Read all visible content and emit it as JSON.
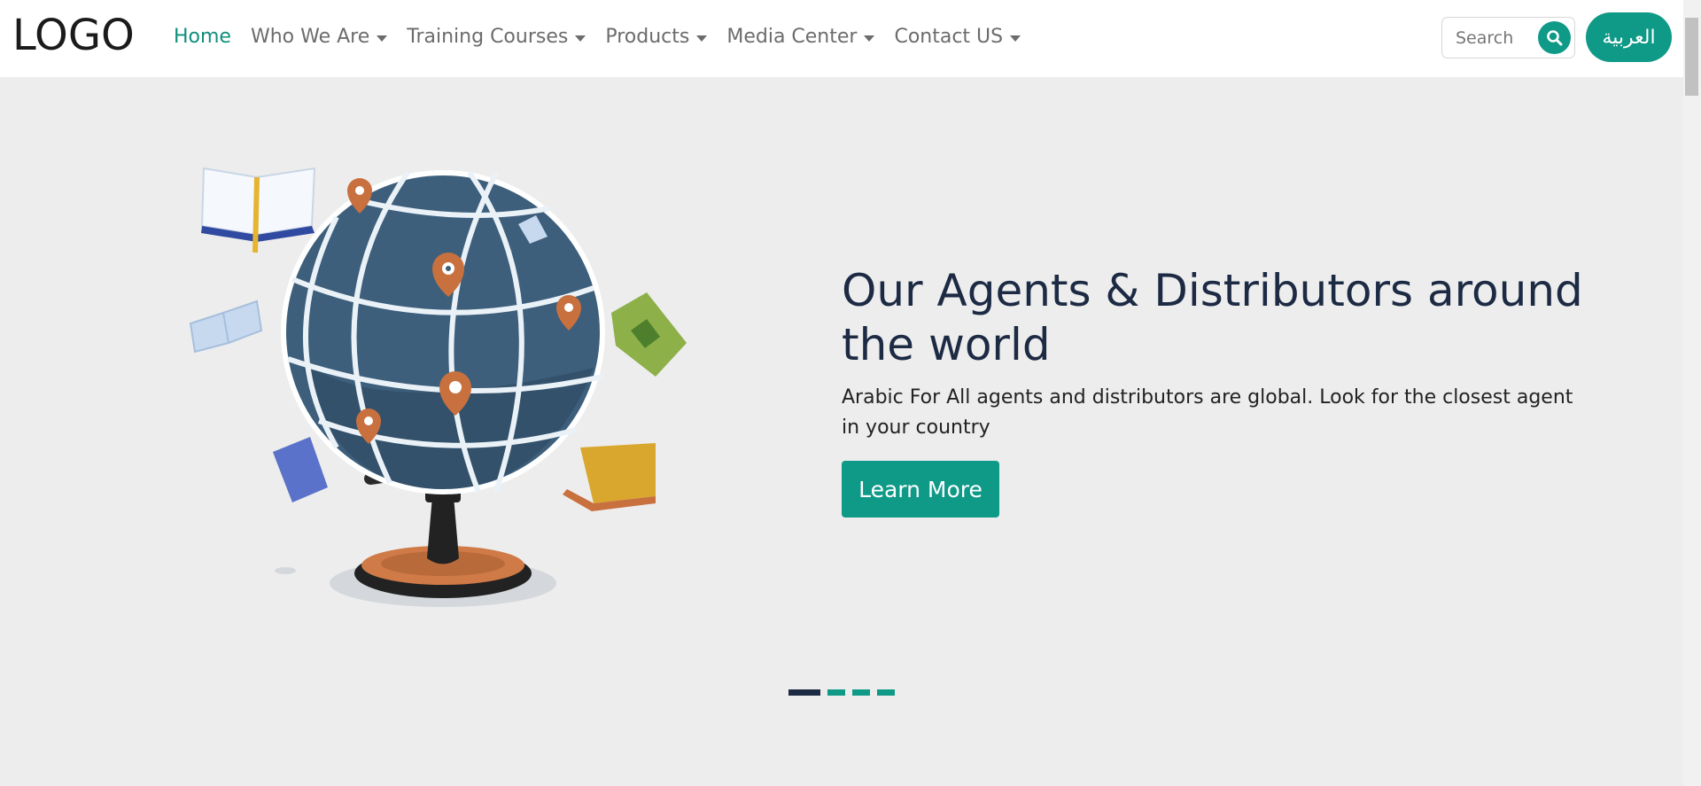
{
  "navbar": {
    "logo": "LOGO",
    "items": [
      {
        "label": "Home",
        "active": true,
        "dropdown": false
      },
      {
        "label": "Who We Are",
        "active": false,
        "dropdown": true
      },
      {
        "label": "Training Courses",
        "active": false,
        "dropdown": true
      },
      {
        "label": "Products",
        "active": false,
        "dropdown": true
      },
      {
        "label": "Media Center",
        "active": false,
        "dropdown": true
      },
      {
        "label": "Contact US",
        "active": false,
        "dropdown": true
      }
    ],
    "search_placeholder": "Search",
    "lang_label": "العربية"
  },
  "hero": {
    "title": "Our Agents & Distributors around the world",
    "text": "Arabic For All agents and distributors are global. Look for the closest agent in your country",
    "button_label": "Learn More"
  },
  "carousel": {
    "slide_count": 4,
    "active_index": 0
  },
  "colors": {
    "accent": "#0f9a88",
    "title": "#1c2a44",
    "background": "#ededed"
  }
}
